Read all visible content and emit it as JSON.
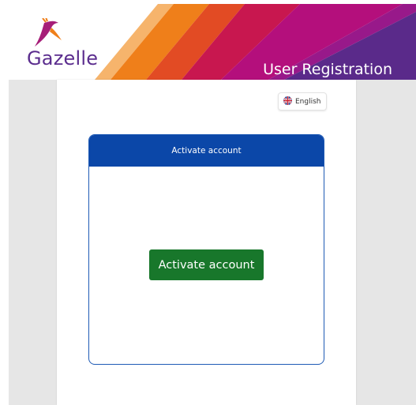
{
  "brand": {
    "name": "Gazelle"
  },
  "header": {
    "title": "User Registration"
  },
  "language": {
    "label": "English",
    "icon": "uk-flag-icon"
  },
  "card": {
    "title": "Activate account",
    "button_label": "Activate account"
  },
  "colors": {
    "header_stripes": [
      "#f4a460",
      "#ef7f1a",
      "#e5541e",
      "#c9174f",
      "#b40f7c",
      "#8e1f8a",
      "#5a2a8a"
    ],
    "card_header": "#0b47a8",
    "button": "#18772b",
    "logo_text": "#5b2d8e"
  }
}
